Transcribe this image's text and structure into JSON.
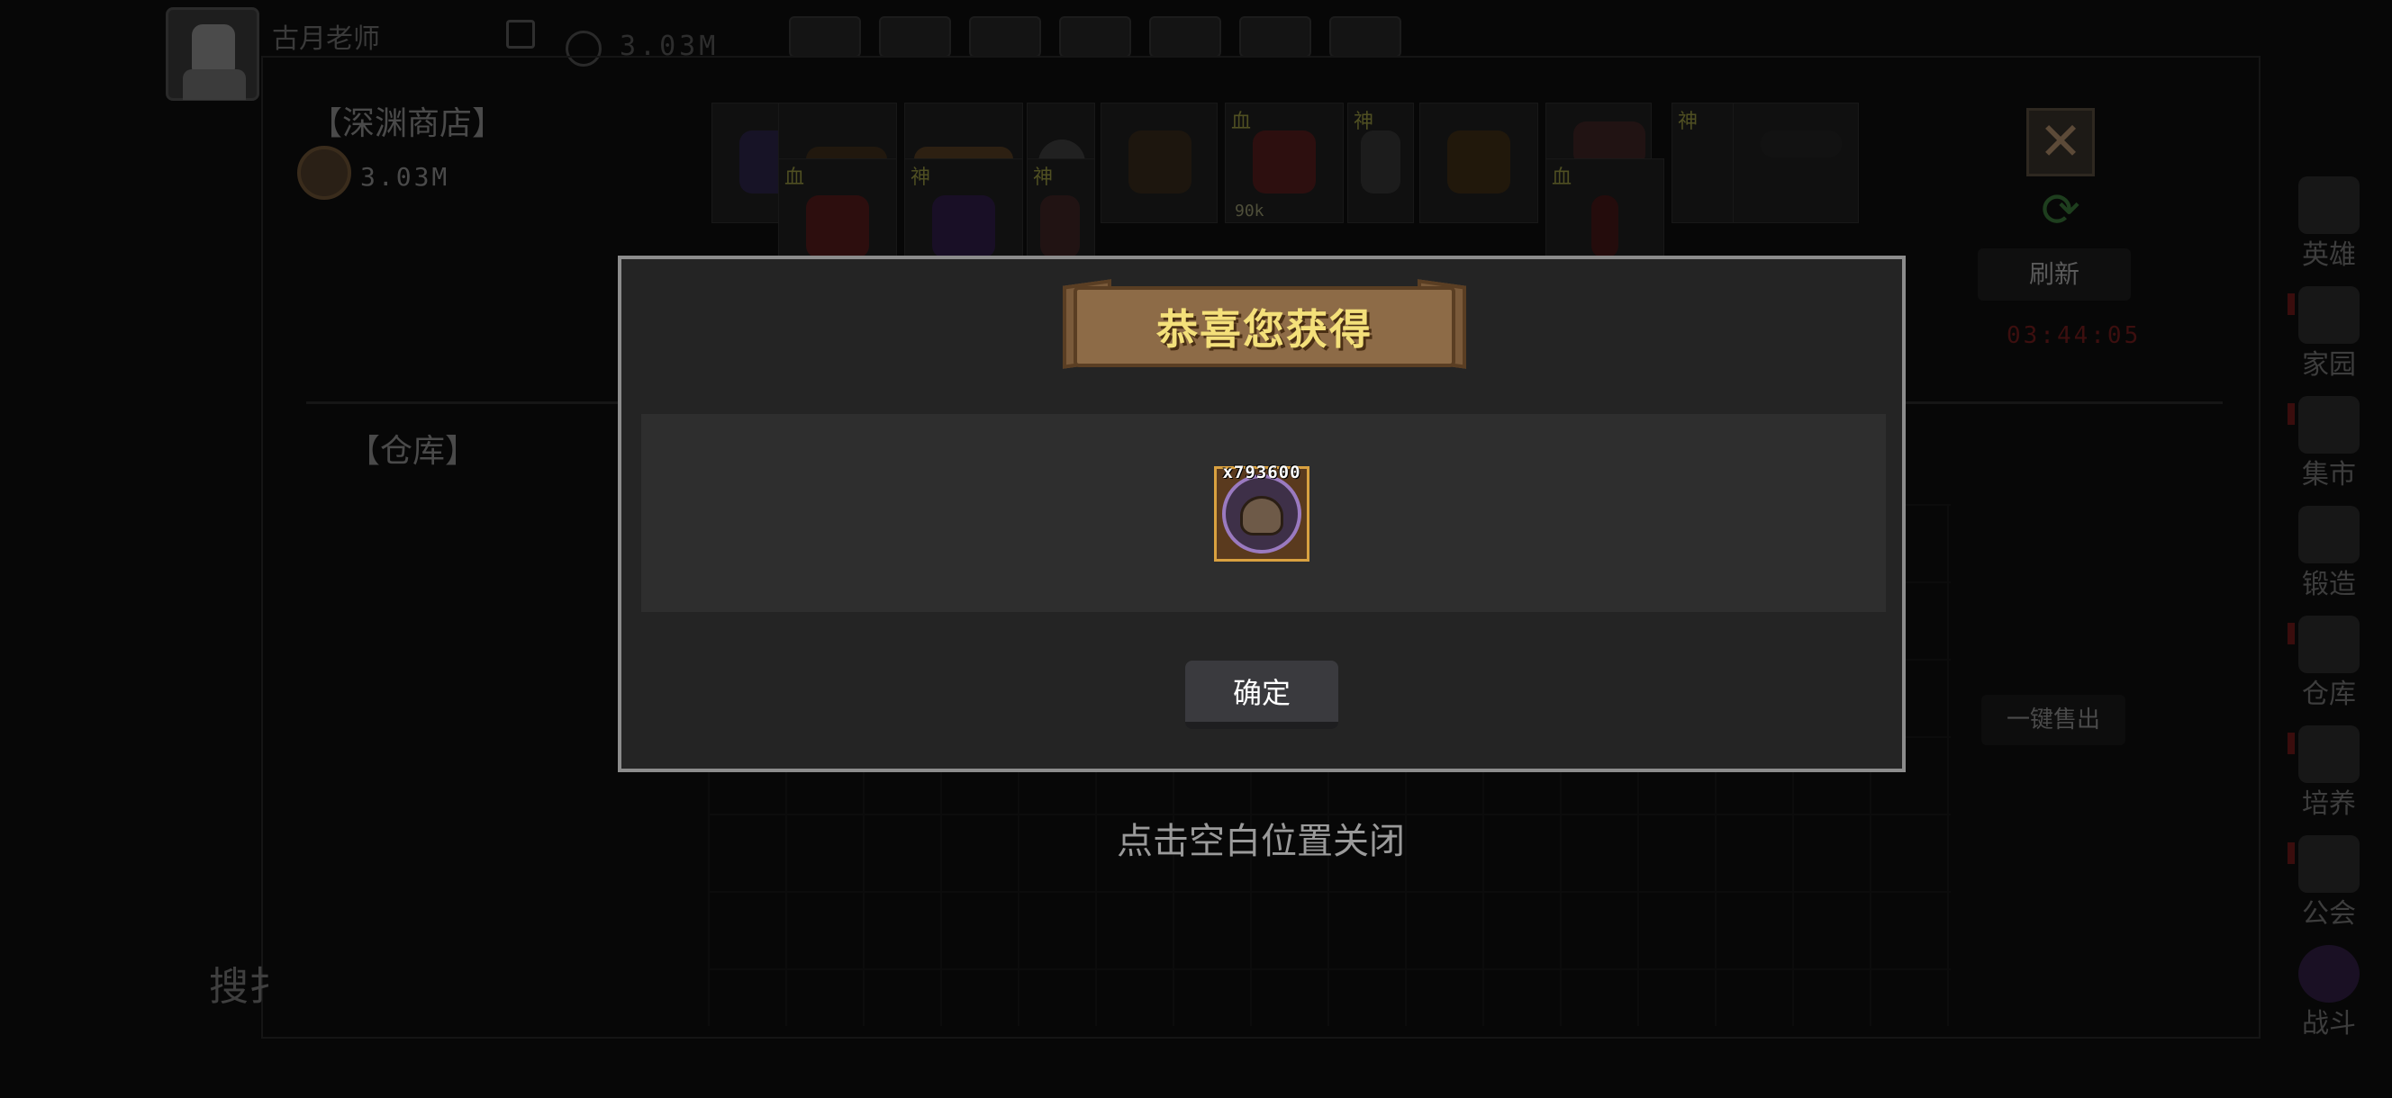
{
  "header": {
    "username": "古月老师",
    "gold": "3.03M",
    "top_icons": [
      "shop-cart-icon",
      "mail-icon",
      "chat-icon",
      "gear-icon",
      "bag-icon",
      "scroll-icon",
      "sword-icon"
    ]
  },
  "shop": {
    "title": "【深渊商店】",
    "gold": "3.03M",
    "refresh_label": "刷新",
    "timer": "03:44:05",
    "items_row1": [
      {
        "icon": "bat-icon",
        "tag": "",
        "qty": ""
      },
      {
        "icon": "fish-icon",
        "tag": "",
        "qty": ""
      },
      {
        "icon": "bread-icon",
        "tag": "",
        "qty": ""
      },
      {
        "icon": "pearl-icon",
        "tag": "",
        "qty": ""
      },
      {
        "icon": "creature-icon",
        "tag": "",
        "qty": ""
      },
      {
        "icon": "potion-icon",
        "tag": "血",
        "qty": "90k"
      },
      {
        "icon": "jar-icon",
        "tag": "神",
        "qty": ""
      },
      {
        "icon": "trophy-icon",
        "tag": "",
        "qty": ""
      },
      {
        "icon": "cards-icon",
        "tag": "",
        "qty": ""
      },
      {
        "icon": "cup-icon",
        "tag": "神",
        "qty": ""
      }
    ],
    "items_row2": [
      {
        "icon": "red-potion-icon",
        "tag": "血",
        "qty": ""
      },
      {
        "icon": "magic-staff-icon",
        "tag": "神",
        "qty": ""
      },
      {
        "icon": "bear-icon",
        "tag": "神",
        "qty": ""
      },
      {
        "icon": "red-vial-icon",
        "tag": "血",
        "qty": ""
      }
    ]
  },
  "warehouse": {
    "title": "【仓库】",
    "sell_all_label": "一键售出",
    "search_label": "搜扌"
  },
  "sidebar": {
    "items": [
      {
        "label": "英雄",
        "icon": "hero-icon",
        "alert": false
      },
      {
        "label": "家园",
        "icon": "home-icon",
        "alert": true
      },
      {
        "label": "集市",
        "icon": "market-icon",
        "alert": true
      },
      {
        "label": "锻造",
        "icon": "forge-icon",
        "alert": false
      },
      {
        "label": "仓库",
        "icon": "warehouse-icon",
        "alert": true
      },
      {
        "label": "培养",
        "icon": "train-icon",
        "alert": true
      },
      {
        "label": "公会",
        "icon": "guild-icon",
        "alert": true
      },
      {
        "label": "战斗",
        "icon": "battle-icon",
        "alert": false
      }
    ]
  },
  "modal": {
    "title": "恭喜您获得",
    "reward": {
      "icon": "helmet-medal-icon",
      "count": "x793600"
    },
    "confirm_label": "确定",
    "close_hint": "点击空白位置关闭"
  },
  "colors": {
    "modal_border": "#8c8c8c",
    "banner_text": "#f4e07a",
    "reward_border": "#d9a140"
  }
}
